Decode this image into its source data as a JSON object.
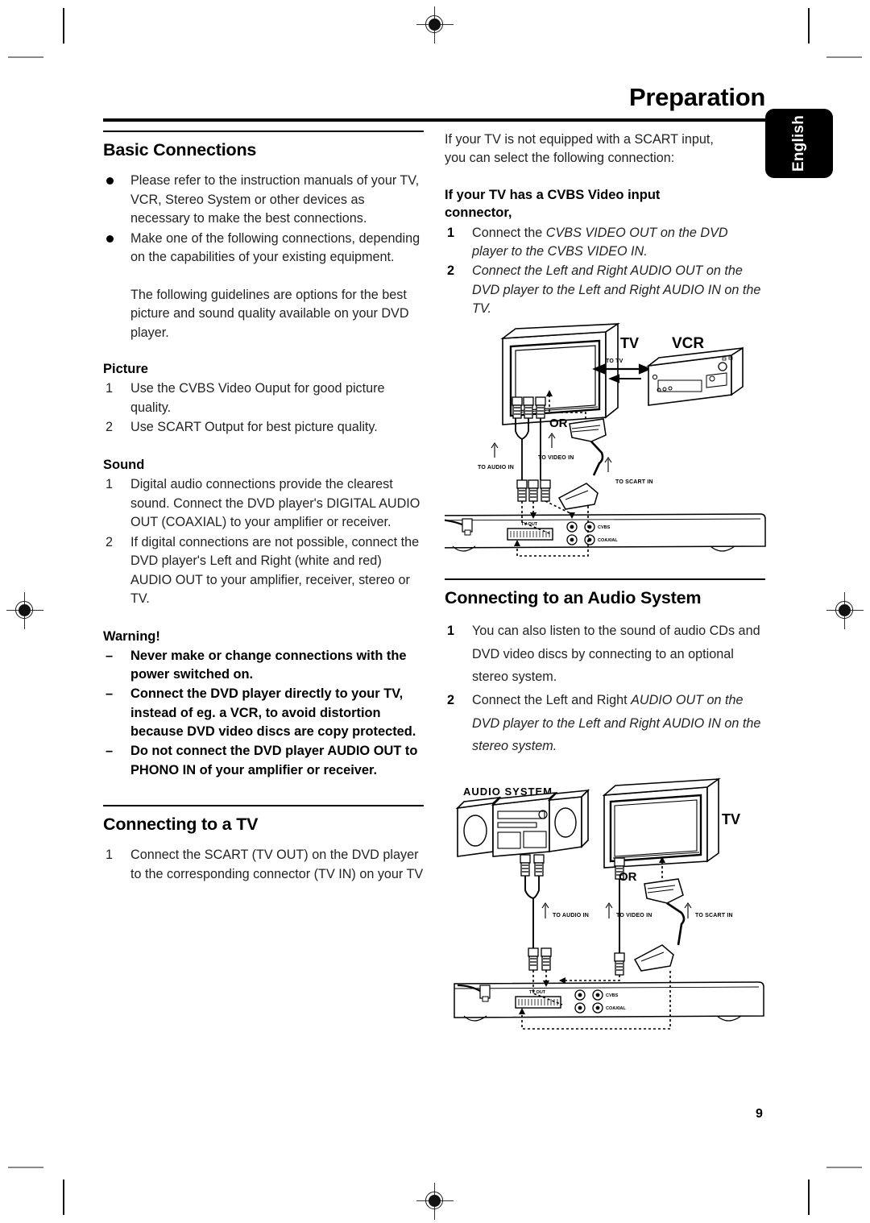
{
  "header": {
    "title": "Preparation",
    "language_tab": "English"
  },
  "page_number": "9",
  "left_column": {
    "section_title": "Basic Connections",
    "intro_bullets": [
      "Please refer to the instruction manuals of your TV, VCR, Stereo System or other devices as necessary to make the best connections.",
      "Make one of the following connections, depending on the capabilities of your existing equipment."
    ],
    "intro_paragraph": "The following guidelines are options for the best picture and sound quality available on your DVD player.",
    "picture": {
      "heading": "Picture",
      "items": [
        "Use the CVBS Video Ouput for good picture quality.",
        "Use SCART Output for best picture quality."
      ]
    },
    "sound": {
      "heading": "Sound",
      "items": [
        "Digital audio connections provide the clearest sound. Connect the DVD player's DIGITAL AUDIO OUT (COAXIAL) to your amplifier or receiver.",
        "If digital connections are not possible, connect the DVD player's Left and Right (white and red) AUDIO OUT to your amplifier, receiver, stereo or TV."
      ]
    },
    "warning": {
      "heading": "Warning!",
      "dash": "–",
      "items": [
        "Never make or change connections with the power switched on.",
        "Connect the DVD player directly to your TV, instead of eg. a VCR,  to avoid distortion because DVD video discs are copy protected.",
        "Do not connect the DVD player AUDIO OUT to PHONO IN of your amplifier or receiver."
      ]
    },
    "connecting_tv": {
      "section_title": "Connecting to a TV",
      "items": [
        "Connect the SCART (TV OUT) on the DVD player to the corresponding connector (TV IN) on your TV"
      ]
    }
  },
  "right_column": {
    "intro_paragraph": "If your TV is not equipped with a SCART input, you can select the following connection:",
    "cvbs": {
      "heading": "If your TV has a CVBS Video input connector,",
      "items": [
        {
          "pre": "Connect the ",
          "ital": "CVBS VIDEO OUT on the DVD player to the CVBS VIDEO IN."
        },
        {
          "pre": "",
          "ital": "Connect the Left and Right AUDIO OUT on the DVD player to the Left and Right AUDIO IN on the TV."
        }
      ]
    },
    "audio_system": {
      "section_title": "Connecting to an Audio System",
      "items": [
        {
          "pre": "You can also listen to the sound of audio CDs and DVD video discs by connecting to an optional stereo system.",
          "ital": ""
        },
        {
          "pre": "Connect the Left and Right ",
          "ital": "AUDIO OUT on the DVD player to the Left and Right AUDIO IN on the stereo system."
        }
      ]
    }
  },
  "diagram_tv_vcr": {
    "labels": {
      "tv": "TV",
      "vcr": "VCR",
      "to_tv": "TO TV",
      "or": "OR",
      "to_audio_in": "TO AUDIO IN",
      "to_video_in": "TO VIDEO IN",
      "to_scart_in": "TO SCART IN",
      "tv_out": "TV OUT",
      "cvbs": "CVBS",
      "coaxial": "COAXIAL"
    }
  },
  "diagram_audio_system": {
    "labels": {
      "audio_system": "AUDIO SYSTEM",
      "tv": "TV",
      "or": "OR",
      "to_audio_in": "TO AUDIO IN",
      "to_video_in": "TO VIDEO IN",
      "to_scart_in": "TO SCART IN",
      "tv_out": "TV OUT",
      "cvbs": "CVBS",
      "coaxial": "COAXIAL"
    }
  }
}
